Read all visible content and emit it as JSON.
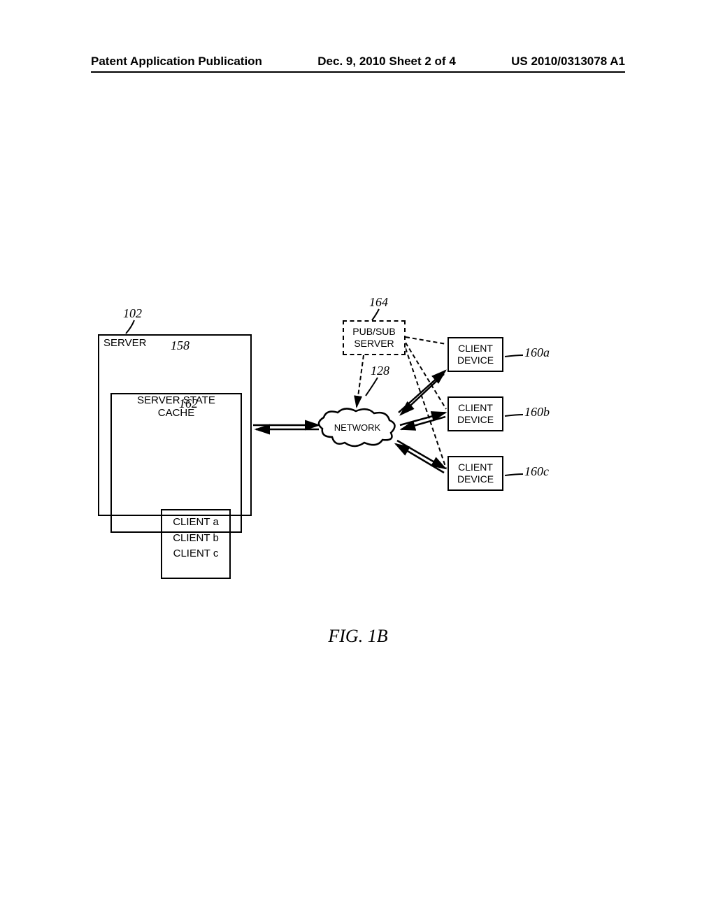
{
  "header": {
    "left": "Patent Application Publication",
    "center": "Dec. 9, 2010  Sheet 2 of 4",
    "right": "US 2010/0313078 A1"
  },
  "diagram": {
    "server_label": "SERVER",
    "cache_label": "SERVER STATE CACHE",
    "clients_list": [
      "CLIENT a",
      "CLIENT b",
      "CLIENT c"
    ],
    "pubsub_label": "PUB/SUB SERVER",
    "network_label": "NETWORK",
    "client_device_label": "CLIENT DEVICE",
    "refs": {
      "r102": "102",
      "r158": "158",
      "r162": "162",
      "r164": "164",
      "r128": "128",
      "r160a": "160a",
      "r160b": "160b",
      "r160c": "160c"
    },
    "figure_caption": "FIG. 1B"
  }
}
